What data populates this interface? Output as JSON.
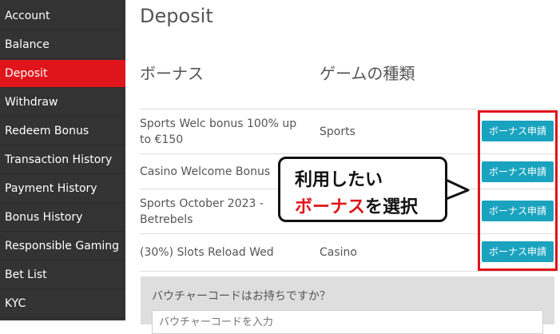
{
  "sidebar": {
    "items": [
      {
        "label": "Account",
        "active": false
      },
      {
        "label": "Balance",
        "active": false
      },
      {
        "label": "Deposit",
        "active": true
      },
      {
        "label": "Withdraw",
        "active": false
      },
      {
        "label": "Redeem Bonus",
        "active": false
      },
      {
        "label": "Transaction History",
        "active": false
      },
      {
        "label": "Payment History",
        "active": false
      },
      {
        "label": "Bonus History",
        "active": false
      },
      {
        "label": "Responsible Gaming",
        "active": false
      },
      {
        "label": "Bet List",
        "active": false
      },
      {
        "label": "KYC",
        "active": false
      }
    ]
  },
  "main": {
    "title": "Deposit",
    "columns": {
      "bonus": "ボーナス",
      "game_type": "ゲームの種類"
    },
    "rows": [
      {
        "name": "Sports Welc bonus 100% up to €150",
        "game": "Sports",
        "button": "ボーナス申請"
      },
      {
        "name": "Casino Welcome Bonus",
        "game": "",
        "button": "ボーナス申請"
      },
      {
        "name": "Sports October 2023 - Betrebels",
        "game": "",
        "button": "ボーナス申請"
      },
      {
        "name": "(30%) Slots Reload Wed",
        "game": "Casino",
        "button": "ボーナス申請"
      }
    ],
    "voucher": {
      "label": "バウチャーコードはお持ちですか？",
      "placeholder": "バウチャーコードを入力"
    }
  },
  "callout": {
    "line1": "利用したい",
    "line2_highlight": "ボーナス",
    "line2_rest": "を選択"
  },
  "colors": {
    "sidebar_bg": "#333333",
    "active": "#e0151b",
    "button": "#1aa3bf"
  }
}
